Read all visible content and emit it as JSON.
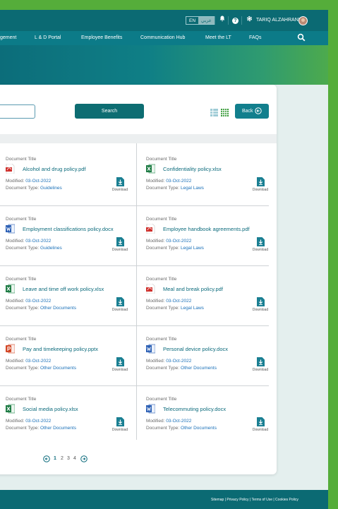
{
  "topbar": {
    "lang_en": "EN",
    "lang_ar": "عربي",
    "bell_icon": "bell-icon",
    "help_icon": "help-icon",
    "settings_icon": "gear-icon",
    "username": "TARIQ ALZAHRANI"
  },
  "nav": {
    "items": [
      "gement",
      "L & D Portal",
      "Employee Benefits",
      "Communication Hub",
      "Meet the LT",
      "FAQs"
    ],
    "search_icon": "search-icon"
  },
  "toolbar": {
    "search_value": "",
    "search_label": "Search",
    "back_label": "Back"
  },
  "documents": [
    {
      "caption": "Document Title",
      "name": "Alcohol and drug policy.pdf",
      "type": "pdf",
      "modified_label": "Modified:",
      "modified": "03-Oct-2022",
      "doctype_label": "Document Type:",
      "doctype": "Guidelines",
      "download": "Download"
    },
    {
      "caption": "Document Title",
      "name": "Confidentiality policy.xlsx",
      "type": "xlsx",
      "modified_label": "Modified:",
      "modified": "03-Oct-2022",
      "doctype_label": "Document Type:",
      "doctype": "Legal Laws",
      "download": "Download"
    },
    {
      "caption": "Document Title",
      "name": "Employment classifications policy.docx",
      "type": "docx",
      "modified_label": "Modified:",
      "modified": "03-Oct-2022",
      "doctype_label": "Document Type:",
      "doctype": "Guidelines",
      "download": "Download"
    },
    {
      "caption": "Document Title",
      "name": "Employee handbook agreements.pdf",
      "type": "pdf",
      "modified_label": "Modified:",
      "modified": "03-Oct-2022",
      "doctype_label": "Document Type:",
      "doctype": "Legal Laws",
      "download": "Download"
    },
    {
      "caption": "Document Title",
      "name": "Leave and time off work policy.xlsx",
      "type": "xlsx",
      "modified_label": "Modified:",
      "modified": "03-Oct-2022",
      "doctype_label": "Document Type:",
      "doctype": "Other Documents",
      "download": "Download"
    },
    {
      "caption": "Document Title",
      "name": "Meal and break policy.pdf",
      "type": "pdf",
      "modified_label": "Modified:",
      "modified": "03-Oct-2022",
      "doctype_label": "Document Type:",
      "doctype": "Legal Laws",
      "download": "Download"
    },
    {
      "caption": "Document Title",
      "name": "Pay and timekeeping policy.pptx",
      "type": "pptx",
      "modified_label": "Modified:",
      "modified": "03-Oct-2022",
      "doctype_label": "Document Type:",
      "doctype": "Other Documents",
      "download": "Download"
    },
    {
      "caption": "Document Title",
      "name": "Personal device policy.docx",
      "type": "docx",
      "modified_label": "Modified:",
      "modified": "03-Oct-2022",
      "doctype_label": "Document Type:",
      "doctype": "Other Documents",
      "download": "Download"
    },
    {
      "caption": "Document Title",
      "name": "Social media policy.xlsx",
      "type": "xlsx",
      "modified_label": "Modified:",
      "modified": "03-Oct-2022",
      "doctype_label": "Document Type:",
      "doctype": "Other Documents",
      "download": "Download"
    },
    {
      "caption": "Document Title",
      "name": "Telecommuting policy.docx",
      "type": "docx",
      "modified_label": "Modified:",
      "modified": "03-Oct-2022",
      "doctype_label": "Document Type:",
      "doctype": "Other Documents",
      "download": "Download"
    }
  ],
  "pagination": {
    "pages": [
      "1",
      "2",
      "3",
      "4"
    ],
    "current": "1"
  },
  "footer": {
    "links": "Sitemap  |  Privacy Policy  |  Terms of Use  |  Cookies Policy"
  },
  "colors": {
    "brand_teal": "#0b6a73",
    "accent_green": "#55ad3a",
    "link_blue": "#1a70b8"
  }
}
